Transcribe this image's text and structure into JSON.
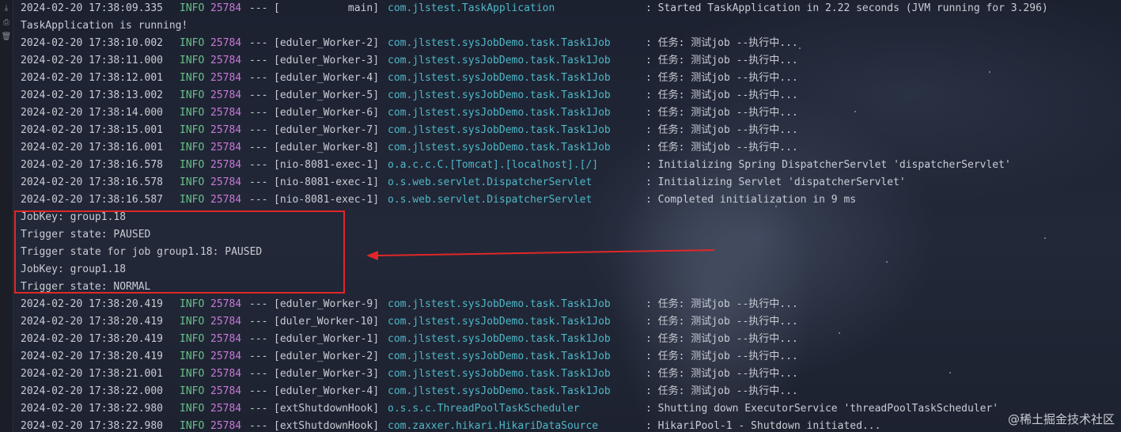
{
  "gutter": {
    "icons": [
      "download-arrow-icon",
      "print-icon",
      "trash-icon"
    ]
  },
  "console": {
    "lines": [
      {
        "type": "log",
        "ts": "2024-02-20 17:38:09.335",
        "level": "INFO",
        "pid": "25784",
        "dash": "---",
        "thread": "[           main]",
        "logger": "com.jlstest.TaskApplication",
        "msg": ": Started TaskApplication in 2.22 seconds (JVM running for 3.296)"
      },
      {
        "type": "plain",
        "text": "TaskApplication is running!"
      },
      {
        "type": "log",
        "ts": "2024-02-20 17:38:10.002",
        "level": "INFO",
        "pid": "25784",
        "dash": "---",
        "thread": "[eduler_Worker-2]",
        "logger": "com.jlstest.sysJobDemo.task.Task1Job",
        "msg": ": 任务: 测试job --执行中..."
      },
      {
        "type": "log",
        "ts": "2024-02-20 17:38:11.000",
        "level": "INFO",
        "pid": "25784",
        "dash": "---",
        "thread": "[eduler_Worker-3]",
        "logger": "com.jlstest.sysJobDemo.task.Task1Job",
        "msg": ": 任务: 测试job --执行中..."
      },
      {
        "type": "log",
        "ts": "2024-02-20 17:38:12.001",
        "level": "INFO",
        "pid": "25784",
        "dash": "---",
        "thread": "[eduler_Worker-4]",
        "logger": "com.jlstest.sysJobDemo.task.Task1Job",
        "msg": ": 任务: 测试job --执行中..."
      },
      {
        "type": "log",
        "ts": "2024-02-20 17:38:13.002",
        "level": "INFO",
        "pid": "25784",
        "dash": "---",
        "thread": "[eduler_Worker-5]",
        "logger": "com.jlstest.sysJobDemo.task.Task1Job",
        "msg": ": 任务: 测试job --执行中..."
      },
      {
        "type": "log",
        "ts": "2024-02-20 17:38:14.000",
        "level": "INFO",
        "pid": "25784",
        "dash": "---",
        "thread": "[eduler_Worker-6]",
        "logger": "com.jlstest.sysJobDemo.task.Task1Job",
        "msg": ": 任务: 测试job --执行中..."
      },
      {
        "type": "log",
        "ts": "2024-02-20 17:38:15.001",
        "level": "INFO",
        "pid": "25784",
        "dash": "---",
        "thread": "[eduler_Worker-7]",
        "logger": "com.jlstest.sysJobDemo.task.Task1Job",
        "msg": ": 任务: 测试job --执行中..."
      },
      {
        "type": "log",
        "ts": "2024-02-20 17:38:16.001",
        "level": "INFO",
        "pid": "25784",
        "dash": "---",
        "thread": "[eduler_Worker-8]",
        "logger": "com.jlstest.sysJobDemo.task.Task1Job",
        "msg": ": 任务: 测试job --执行中..."
      },
      {
        "type": "log",
        "ts": "2024-02-20 17:38:16.578",
        "level": "INFO",
        "pid": "25784",
        "dash": "---",
        "thread": "[nio-8081-exec-1]",
        "logger": "o.a.c.c.C.[Tomcat].[localhost].[/]",
        "msg": ": Initializing Spring DispatcherServlet 'dispatcherServlet'"
      },
      {
        "type": "log",
        "ts": "2024-02-20 17:38:16.578",
        "level": "INFO",
        "pid": "25784",
        "dash": "---",
        "thread": "[nio-8081-exec-1]",
        "logger": "o.s.web.servlet.DispatcherServlet",
        "msg": ": Initializing Servlet 'dispatcherServlet'"
      },
      {
        "type": "log",
        "ts": "2024-02-20 17:38:16.587",
        "level": "INFO",
        "pid": "25784",
        "dash": "---",
        "thread": "[nio-8081-exec-1]",
        "logger": "o.s.web.servlet.DispatcherServlet",
        "msg": ": Completed initialization in 9 ms"
      },
      {
        "type": "plain",
        "text": "JobKey: group1.18"
      },
      {
        "type": "plain",
        "text": "Trigger state: PAUSED"
      },
      {
        "type": "plain",
        "text": "Trigger state for job group1.18: PAUSED"
      },
      {
        "type": "plain",
        "text": "JobKey: group1.18"
      },
      {
        "type": "plain",
        "text": "Trigger state: NORMAL"
      },
      {
        "type": "log",
        "ts": "2024-02-20 17:38:20.419",
        "level": "INFO",
        "pid": "25784",
        "dash": "---",
        "thread": "[eduler_Worker-9]",
        "logger": "com.jlstest.sysJobDemo.task.Task1Job",
        "msg": ": 任务: 测试job --执行中..."
      },
      {
        "type": "log",
        "ts": "2024-02-20 17:38:20.419",
        "level": "INFO",
        "pid": "25784",
        "dash": "---",
        "thread": "[duler_Worker-10]",
        "logger": "com.jlstest.sysJobDemo.task.Task1Job",
        "msg": ": 任务: 测试job --执行中..."
      },
      {
        "type": "log",
        "ts": "2024-02-20 17:38:20.419",
        "level": "INFO",
        "pid": "25784",
        "dash": "---",
        "thread": "[eduler_Worker-1]",
        "logger": "com.jlstest.sysJobDemo.task.Task1Job",
        "msg": ": 任务: 测试job --执行中..."
      },
      {
        "type": "log",
        "ts": "2024-02-20 17:38:20.419",
        "level": "INFO",
        "pid": "25784",
        "dash": "---",
        "thread": "[eduler_Worker-2]",
        "logger": "com.jlstest.sysJobDemo.task.Task1Job",
        "msg": ": 任务: 测试job --执行中..."
      },
      {
        "type": "log",
        "ts": "2024-02-20 17:38:21.001",
        "level": "INFO",
        "pid": "25784",
        "dash": "---",
        "thread": "[eduler_Worker-3]",
        "logger": "com.jlstest.sysJobDemo.task.Task1Job",
        "msg": ": 任务: 测试job --执行中..."
      },
      {
        "type": "log",
        "ts": "2024-02-20 17:38:22.000",
        "level": "INFO",
        "pid": "25784",
        "dash": "---",
        "thread": "[eduler_Worker-4]",
        "logger": "com.jlstest.sysJobDemo.task.Task1Job",
        "msg": ": 任务: 测试job --执行中..."
      },
      {
        "type": "log",
        "ts": "2024-02-20 17:38:22.980",
        "level": "INFO",
        "pid": "25784",
        "dash": "---",
        "thread": "[extShutdownHook]",
        "logger": "o.s.s.c.ThreadPoolTaskScheduler",
        "msg": ": Shutting down ExecutorService 'threadPoolTaskScheduler'"
      },
      {
        "type": "log",
        "ts": "2024-02-20 17:38:22.980",
        "level": "INFO",
        "pid": "25784",
        "dash": "---",
        "thread": "[extShutdownHook]",
        "logger": "com.zaxxer.hikari.HikariDataSource",
        "msg": ": HikariPool-1 - Shutdown initiated..."
      }
    ]
  },
  "annotation": {
    "box_color": "#e02727",
    "arrow_color": "#e02727"
  },
  "watermark": {
    "text": "@稀土掘金技术社区"
  },
  "colors": {
    "level_info": "#6bbf8a",
    "pid": "#c879d9",
    "logger": "#4fb7c7",
    "text": "#c8ccd4",
    "background": "#1f2330"
  }
}
